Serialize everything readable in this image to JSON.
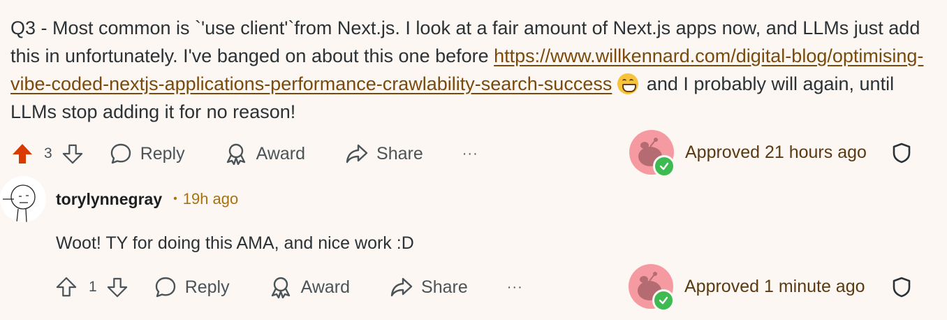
{
  "comment1": {
    "text_before_link": "Q3 - Most common is `'use client'`from Next.js. I look at a fair amount of Next.js apps now, and LLMs just add this in unfortunately. I've banged on about this one before ",
    "link_text": "https://www.willkennard.com/digital-blog/optimising-vibe-coded-nextjs-applications-performance-crawlability-search-success",
    "emoji": "grinning-face-icon",
    "text_after_link": " and I probably will again, until LLMs stop adding it for no reason!",
    "votes": "3",
    "upvoted": true,
    "actions": {
      "reply": "Reply",
      "award": "Award",
      "share": "Share",
      "more": "···"
    },
    "status": "Approved 21 hours ago"
  },
  "comment2": {
    "username": "torylynnegray",
    "separator": "•",
    "time": "19h ago",
    "text": "Woot! TY for doing this AMA, and nice work :D",
    "votes": "1",
    "upvoted": false,
    "actions": {
      "reply": "Reply",
      "award": "Award",
      "share": "Share",
      "more": "···"
    },
    "status": "Approved 1 minute ago"
  },
  "colors": {
    "background": "#fdf7f4",
    "upvote_active": "#d93a00",
    "link": "#7a4a0b",
    "approved_badge": "#3dbb52",
    "mod_avatar": "#f69aa2"
  }
}
